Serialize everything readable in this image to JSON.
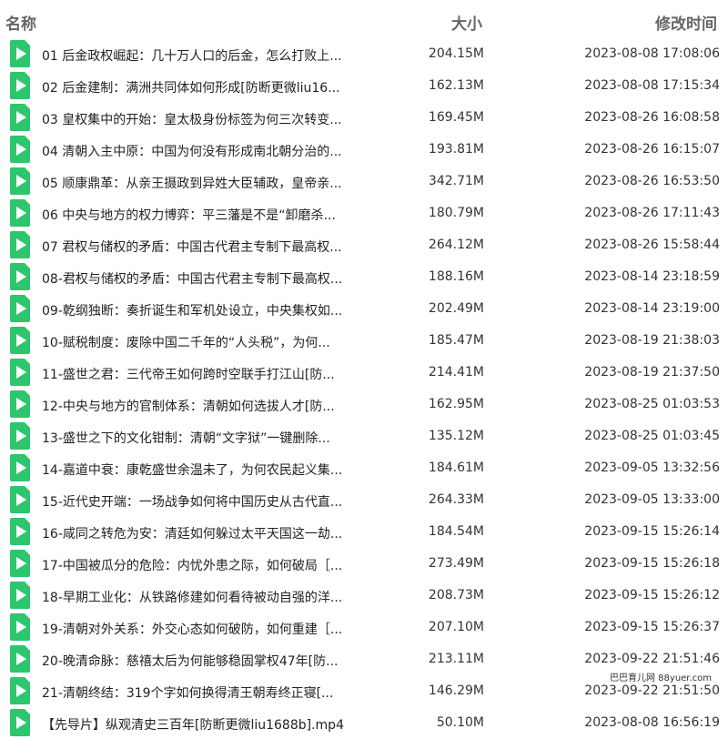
{
  "header": {
    "name": "名称",
    "size": "大小",
    "time": "修改时间"
  },
  "files": [
    {
      "name": "01 后金政权崛起：几十万人口的后金，怎么打败上...",
      "size": "204.15M",
      "time": "2023-08-08 17:08:06"
    },
    {
      "name": "02 后金建制：满洲共同体如何形成[防断更微liu16...",
      "size": "162.13M",
      "time": "2023-08-08 17:15:34"
    },
    {
      "name": "03 皇权集中的开始：皇太极身份标签为何三次转变...",
      "size": "169.45M",
      "time": "2023-08-26 16:08:58"
    },
    {
      "name": "04 清朝入主中原：中国为何没有形成南北朝分治的...",
      "size": "193.81M",
      "time": "2023-08-26 16:15:07"
    },
    {
      "name": "05 顺康鼎革：从亲王摄政到异姓大臣辅政，皇帝亲...",
      "size": "342.71M",
      "time": "2023-08-26 16:53:50"
    },
    {
      "name": "06 中央与地方的权力博弈：平三藩是不是“卸磨杀...",
      "size": "180.79M",
      "time": "2023-08-26 17:11:43"
    },
    {
      "name": "07 君权与储权的矛盾：中国古代君主专制下最高权...",
      "size": "264.12M",
      "time": "2023-08-26 15:58:44"
    },
    {
      "name": "08-君权与储权的矛盾：中国古代君主专制下最高权...",
      "size": "188.16M",
      "time": "2023-08-14 23:18:59"
    },
    {
      "name": "09-乾纲独断：奏折诞生和军机处设立，中央集权如...",
      "size": "202.49M",
      "time": "2023-08-14 23:19:00"
    },
    {
      "name": "10-赋税制度：废除中国二千年的“人头税”，为何...",
      "size": "185.47M",
      "time": "2023-08-19 21:38:03"
    },
    {
      "name": "11-盛世之君：三代帝王如何跨时空联手打江山[防...",
      "size": "214.41M",
      "time": "2023-08-19 21:37:50"
    },
    {
      "name": "12-中央与地方的官制体系：清朝如何选拔人才[防...",
      "size": "162.95M",
      "time": "2023-08-25 01:03:53"
    },
    {
      "name": "13-盛世之下的文化钳制：清朝“文字狱”一键删除...",
      "size": "135.12M",
      "time": "2023-08-25 01:03:45"
    },
    {
      "name": "14-嘉道中衰：康乾盛世余温未了，为何农民起义集...",
      "size": "184.61M",
      "time": "2023-09-05 13:32:56"
    },
    {
      "name": "15-近代史开端：一场战争如何将中国历史从古代直...",
      "size": "264.33M",
      "time": "2023-09-05 13:33:00"
    },
    {
      "name": "16-咸同之转危为安：清廷如何躲过太平天国这一劫...",
      "size": "184.54M",
      "time": "2023-09-15 15:26:14"
    },
    {
      "name": "17-中国被瓜分的危险：内忧外患之际，如何破局［...",
      "size": "273.49M",
      "time": "2023-09-15 15:26:18"
    },
    {
      "name": "18-早期工业化：从铁路修建如何看待被动自强的洋...",
      "size": "208.73M",
      "time": "2023-09-15 15:26:12"
    },
    {
      "name": "19-清朝对外关系：外交心态如何破防，如何重建［...",
      "size": "207.10M",
      "time": "2023-09-15 15:26:37"
    },
    {
      "name": "20-晚清命脉：慈禧太后为何能够稳固掌权47年[防...",
      "size": "213.11M",
      "time": "2023-09-22 21:51:46"
    },
    {
      "name": "21-清朝终结：319个字如何换得清王朝寿终正寝[...",
      "size": "146.29M",
      "time": "2023-09-22 21:51:50"
    },
    {
      "name": "【先导片】纵观清史三百年[防断更微liu1688b].mp4",
      "size": "50.10M",
      "time": "2023-08-08 16:56:19"
    }
  ],
  "watermark": "巴巴育儿网 88yuer.com"
}
